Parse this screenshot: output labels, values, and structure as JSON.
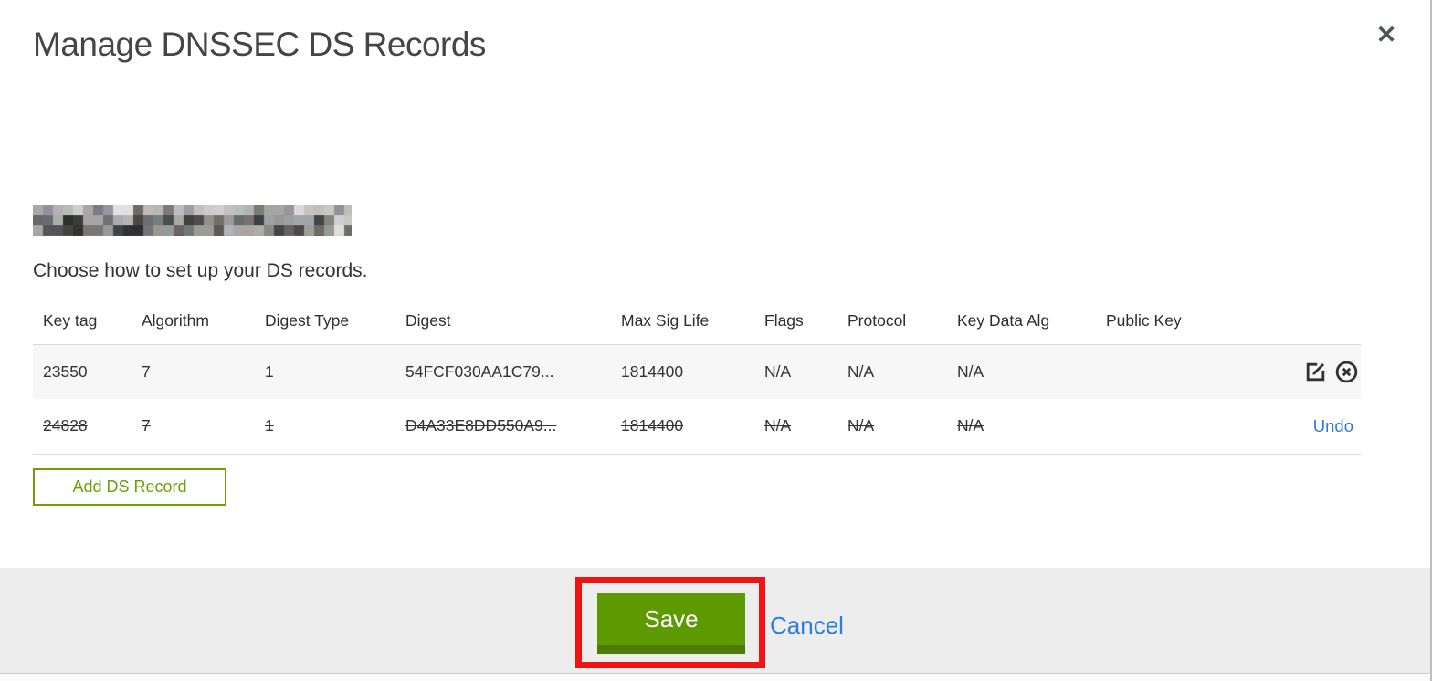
{
  "modal": {
    "title": "Manage DNSSEC DS Records",
    "close_icon": "✕",
    "intro": "Choose how to set up your DS records.",
    "table": {
      "columns": [
        "Key tag",
        "Algorithm",
        "Digest Type",
        "Digest",
        "Max Sig Life",
        "Flags",
        "Protocol",
        "Key Data Alg",
        "Public Key"
      ],
      "rows": [
        {
          "key_tag": "23550",
          "algorithm": "7",
          "digest_type": "1",
          "digest": "54FCF030AA1C79...",
          "max_sig_life": "1814400",
          "flags": "N/A",
          "protocol": "N/A",
          "key_data_alg": "N/A",
          "public_key": "",
          "state": "current"
        },
        {
          "key_tag": "24828",
          "algorithm": "7",
          "digest_type": "1",
          "digest": "D4A33E8DD550A9...",
          "max_sig_life": "1814400",
          "flags": "N/A",
          "protocol": "N/A",
          "key_data_alg": "N/A",
          "public_key": "",
          "state": "deleted",
          "undo_label": "Undo"
        }
      ]
    },
    "add_button_label": "Add DS Record",
    "footer": {
      "save_label": "Save",
      "cancel_label": "Cancel"
    }
  },
  "colors": {
    "accent_green": "#6f9e06",
    "save_button_green": "#5d9a02",
    "link_blue": "#2b7de3",
    "annotation_red": "#f11212",
    "row_alt_background": "#f7f7f7"
  }
}
